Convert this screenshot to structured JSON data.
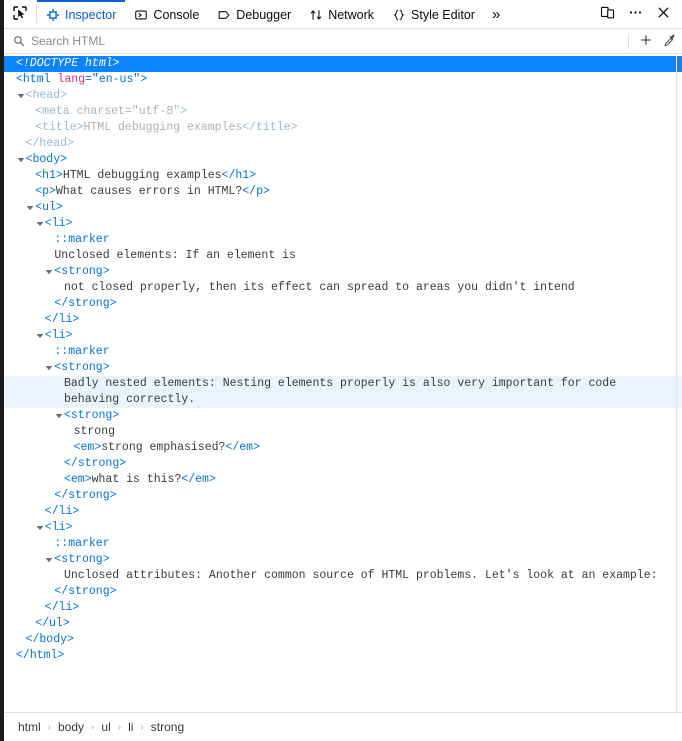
{
  "toolbar": {
    "pick_icon": "element-picker-icon",
    "tabs": [
      {
        "label": "Inspector",
        "icon": "inspector-target-icon",
        "active": true
      },
      {
        "label": "Console",
        "icon": "console-prompt-icon",
        "active": false
      },
      {
        "label": "Debugger",
        "icon": "debugger-tag-icon",
        "active": false
      },
      {
        "label": "Network",
        "icon": "network-arrows-icon",
        "active": false
      },
      {
        "label": "Style Editor",
        "icon": "style-editor-braces-icon",
        "active": false
      }
    ],
    "more_tabs_label": "»",
    "responsive_label": "Responsive Design Mode",
    "meatball_label": "•••",
    "close_label": "✕",
    "accent_color": "#0060df"
  },
  "search": {
    "placeholder": "Search HTML",
    "value": "",
    "add_node_label": "+",
    "eyedropper_label": "Grab a color from the page"
  },
  "markup": {
    "selection_color": "#0a84ff",
    "hover_color": "#eaf3fe",
    "lines": [
      {
        "indent": 0,
        "twisty": "none",
        "state": "selected",
        "kind": "doctype",
        "text": "<!DOCTYPE html>"
      },
      {
        "indent": 0,
        "twisty": "none",
        "kind": "open-tag",
        "tag": "html",
        "attrs": [
          {
            "name": "lang",
            "value": "en-us"
          }
        ]
      },
      {
        "indent": 1,
        "twisty": "open",
        "kind": "open-tag-dim",
        "tag": "head"
      },
      {
        "indent": 2,
        "twisty": "none",
        "kind": "void-tag-dim",
        "tag": "meta",
        "attrs": [
          {
            "name": "charset",
            "value": "utf-8"
          }
        ]
      },
      {
        "indent": 2,
        "twisty": "none",
        "kind": "inline-tag-dim",
        "tag": "title",
        "text": "HTML debugging examples"
      },
      {
        "indent": 1,
        "twisty": "none",
        "kind": "close-tag-dim",
        "tag": "head"
      },
      {
        "indent": 1,
        "twisty": "open",
        "kind": "open-tag",
        "tag": "body"
      },
      {
        "indent": 2,
        "twisty": "none",
        "kind": "inline-tag",
        "tag": "h1",
        "text": "HTML debugging examples"
      },
      {
        "indent": 2,
        "twisty": "none",
        "kind": "inline-tag",
        "tag": "p",
        "text": "What causes errors in HTML?"
      },
      {
        "indent": 2,
        "twisty": "open",
        "kind": "open-tag",
        "tag": "ul"
      },
      {
        "indent": 3,
        "twisty": "open",
        "kind": "open-tag",
        "tag": "li"
      },
      {
        "indent": 4,
        "twisty": "none",
        "kind": "pseudo",
        "text": "::marker"
      },
      {
        "indent": 4,
        "twisty": "none",
        "kind": "textnode",
        "text": "Unclosed elements: If an element is"
      },
      {
        "indent": 4,
        "twisty": "open",
        "kind": "open-tag",
        "tag": "strong"
      },
      {
        "indent": 5,
        "twisty": "none",
        "kind": "textnode",
        "text": "not closed properly, then its effect can spread to areas you didn't intend"
      },
      {
        "indent": 4,
        "twisty": "none",
        "kind": "close-tag",
        "tag": "strong"
      },
      {
        "indent": 3,
        "twisty": "none",
        "kind": "close-tag",
        "tag": "li"
      },
      {
        "indent": 3,
        "twisty": "open",
        "kind": "open-tag",
        "tag": "li"
      },
      {
        "indent": 4,
        "twisty": "none",
        "kind": "pseudo",
        "text": "::marker"
      },
      {
        "indent": 4,
        "twisty": "open",
        "kind": "open-tag",
        "tag": "strong"
      },
      {
        "indent": 5,
        "twisty": "none",
        "kind": "textnode",
        "state": "hovered",
        "text": "Badly nested elements: Nesting elements properly is also very important for code behaving correctly."
      },
      {
        "indent": 5,
        "twisty": "open",
        "kind": "open-tag",
        "tag": "strong"
      },
      {
        "indent": 6,
        "twisty": "none",
        "kind": "textnode",
        "text": "strong"
      },
      {
        "indent": 6,
        "twisty": "none",
        "kind": "inline-tag",
        "tag": "em",
        "text": "strong emphasised?"
      },
      {
        "indent": 5,
        "twisty": "none",
        "kind": "close-tag",
        "tag": "strong"
      },
      {
        "indent": 5,
        "twisty": "none",
        "kind": "inline-tag",
        "tag": "em",
        "text": "what is this?"
      },
      {
        "indent": 4,
        "twisty": "none",
        "kind": "close-tag",
        "tag": "strong"
      },
      {
        "indent": 3,
        "twisty": "none",
        "kind": "close-tag",
        "tag": "li"
      },
      {
        "indent": 3,
        "twisty": "open",
        "kind": "open-tag",
        "tag": "li"
      },
      {
        "indent": 4,
        "twisty": "none",
        "kind": "pseudo",
        "text": "::marker"
      },
      {
        "indent": 4,
        "twisty": "open",
        "kind": "open-tag",
        "tag": "strong"
      },
      {
        "indent": 5,
        "twisty": "none",
        "kind": "textnode",
        "text": "Unclosed attributes: Another common source of HTML problems. Let's look at an example:"
      },
      {
        "indent": 4,
        "twisty": "none",
        "kind": "close-tag",
        "tag": "strong"
      },
      {
        "indent": 3,
        "twisty": "none",
        "kind": "close-tag",
        "tag": "li"
      },
      {
        "indent": 2,
        "twisty": "none",
        "kind": "close-tag",
        "tag": "ul"
      },
      {
        "indent": 1,
        "twisty": "none",
        "kind": "close-tag",
        "tag": "body"
      },
      {
        "indent": 0,
        "twisty": "none",
        "kind": "close-tag",
        "tag": "html"
      }
    ]
  },
  "breadcrumb": {
    "separator": "›",
    "items": [
      "html",
      "body",
      "ul",
      "li",
      "strong"
    ],
    "selected_index": 4
  }
}
